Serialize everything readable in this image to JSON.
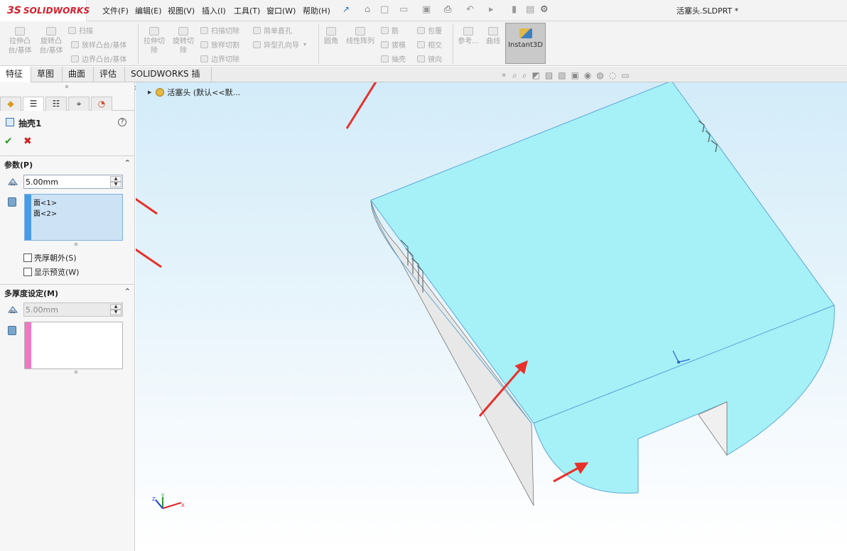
{
  "app": {
    "logo_ds": "3S",
    "logo_text": "SOLIDWORKS",
    "menu": [
      "文件(F)",
      "编辑(E)",
      "视图(V)",
      "插入(I)",
      "工具(T)",
      "窗口(W)",
      "帮助(H)"
    ],
    "document_title": "活塞头.SLDPRT *"
  },
  "quick_access_icons": [
    "home-icon",
    "new-icon",
    "open-icon",
    "save-icon",
    "print-icon",
    "undo-icon",
    "select-icon",
    "rebuild-icon",
    "file-properties-icon",
    "options-icon"
  ],
  "commands": {
    "extrude_boss": "拉伸凸\n台/基体",
    "revolve_boss": "旋转凸\n台/基体",
    "sweep": "扫描",
    "loft_boss": "放样凸台/基体",
    "boundary_boss": "边界凸台/基体",
    "extrude_cut": "拉伸切\n除",
    "revolve_cut": "旋转切\n除",
    "sweep_cut": "扫描切除",
    "loft_cut": "放样切割",
    "boundary_cut": "边界切除",
    "simple_hole": "简单直孔",
    "hole_wizard": "异型孔向导",
    "fillet": "圆角",
    "linear_pattern": "线性阵列",
    "rib": "筋",
    "draft": "拔模",
    "shell": "抽壳",
    "wrap": "包覆",
    "intersect": "相交",
    "mirror": "镜向",
    "reference": "参考...",
    "curves": "曲线",
    "instant3d": "Instant3D"
  },
  "tabs": [
    "特征",
    "草图",
    "曲面",
    "评估",
    "SOLIDWORKS 插件"
  ],
  "active_tab": "特征",
  "property_manager": {
    "title": "抽壳1",
    "parameters_section": "参数(P)",
    "thickness_value": "5.00mm",
    "faces_to_remove": [
      "面<1>",
      "面<2>"
    ],
    "shell_outward_label": "壳厚朝外(S)",
    "shell_outward_checked": false,
    "show_preview_label": "显示预览(W)",
    "show_preview_checked": false,
    "multi_thickness_section": "多厚度设定(M)",
    "multi_thickness_value": "5.00mm"
  },
  "feature_tree": {
    "root_label": "活塞头 (默认<<默..."
  },
  "colors": {
    "accent_blue": "#3a8fd8",
    "face_color": "#a6f0f7",
    "arrow_red": "#e8302a",
    "multi_thickness_bar": "#f078c0"
  }
}
